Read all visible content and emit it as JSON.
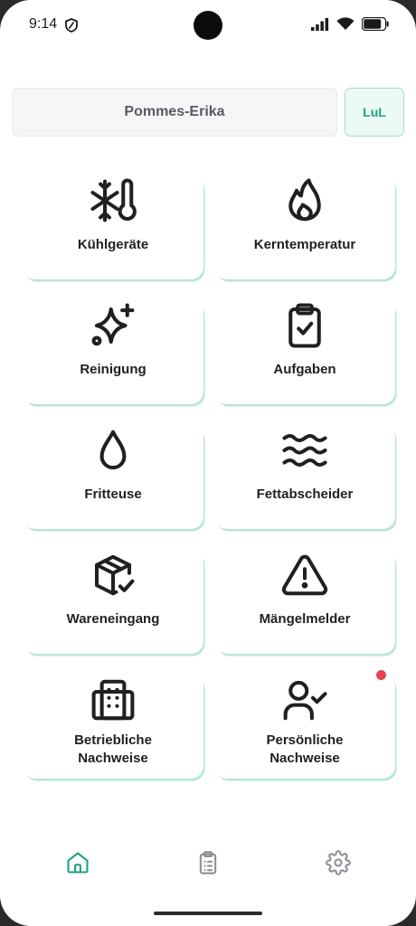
{
  "status_bar": {
    "time": "9:14"
  },
  "header": {
    "store_name": "Pommes-Erika",
    "user_initials": "LuL"
  },
  "tiles": [
    {
      "label": "Kühlgeräte",
      "icon": "snowflake-thermometer-icon"
    },
    {
      "label": "Kerntemperatur",
      "icon": "flame-icon"
    },
    {
      "label": "Reinigung",
      "icon": "sparkles-icon"
    },
    {
      "label": "Aufgaben",
      "icon": "clipboard-check-icon"
    },
    {
      "label": "Fritteuse",
      "icon": "droplet-icon"
    },
    {
      "label": "Fettabscheider",
      "icon": "waves-icon"
    },
    {
      "label": "Wareneingang",
      "icon": "package-check-icon"
    },
    {
      "label": "Mängelmelder",
      "icon": "warning-triangle-icon"
    },
    {
      "label_line1": "Betriebliche",
      "label_line2": "Nachweise",
      "icon": "building-icon"
    },
    {
      "label_line1": "Persönliche",
      "label_line2": "Nachweise",
      "icon": "user-check-icon",
      "has_notification": true
    }
  ],
  "bottom_nav": [
    {
      "icon": "home-icon",
      "active": true
    },
    {
      "icon": "clipboard-list-icon",
      "active": false
    },
    {
      "icon": "gear-icon",
      "active": false
    }
  ],
  "colors": {
    "accent": "#1fa283",
    "tile_shadow": "#b9e6d6",
    "notification": "#e8434a",
    "icon": "#1e2024",
    "nav_inactive": "#8a9098"
  }
}
